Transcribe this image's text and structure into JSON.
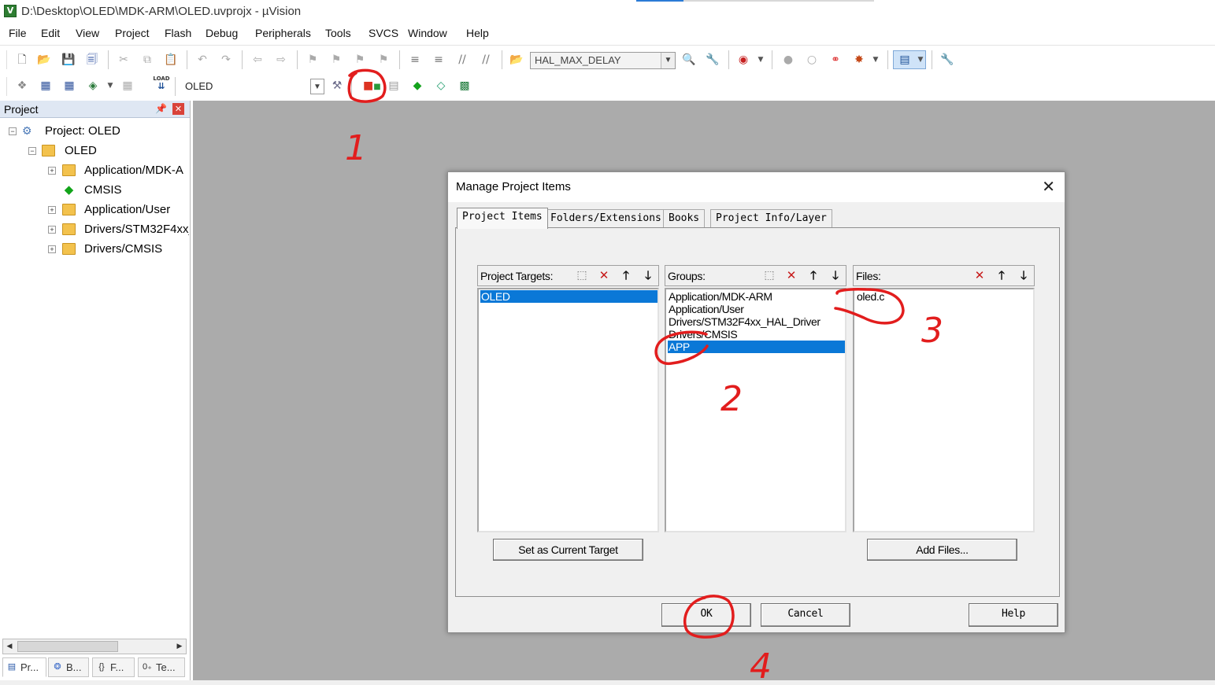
{
  "window": {
    "title": "D:\\Desktop\\OLED\\MDK-ARM\\OLED.uvprojx - µVision",
    "app_icon": "keil-uvision-icon"
  },
  "menu": [
    "File",
    "Edit",
    "View",
    "Project",
    "Flash",
    "Debug",
    "Peripherals",
    "Tools",
    "SVCS",
    "Window",
    "Help"
  ],
  "toolbar1": {
    "find_combo": "HAL_MAX_DELAY"
  },
  "toolbar2": {
    "load_label": "LOAD",
    "target_combo": "OLED"
  },
  "project_panel": {
    "title": "Project",
    "tree": {
      "root": "Project: OLED",
      "target": "OLED",
      "groups": [
        "Application/MDK-A",
        "CMSIS",
        "Application/User",
        "Drivers/STM32F4xx_",
        "Drivers/CMSIS"
      ]
    },
    "bottom_tabs": [
      "Pr...",
      "B...",
      "F...",
      "Te..."
    ]
  },
  "dialog": {
    "title": "Manage Project Items",
    "tabs": [
      "Project Items",
      "Folders/Extensions",
      "Books",
      "Project Info/Layer"
    ],
    "targets": {
      "label": "Project Targets:",
      "items": [
        "OLED"
      ],
      "selected": 0
    },
    "groups": {
      "label": "Groups:",
      "items": [
        "Application/MDK-ARM",
        "Application/User",
        "Drivers/STM32F4xx_HAL_Driver",
        "Drivers/CMSIS",
        "APP"
      ],
      "selected": 4
    },
    "files": {
      "label": "Files:",
      "items": [
        "oled.c"
      ]
    },
    "set_target_button": "Set as Current Target",
    "add_files_button": "Add Files...",
    "ok_button": "OK",
    "cancel_button": "Cancel",
    "help_button": "Help"
  },
  "annotations": {
    "marks": [
      "1",
      "2",
      "3",
      "4"
    ],
    "color": "#e21d1d"
  },
  "colors": {
    "selection": "#0a78d7",
    "workspace": "#ababab",
    "panel_header": "#dfe7f3"
  }
}
